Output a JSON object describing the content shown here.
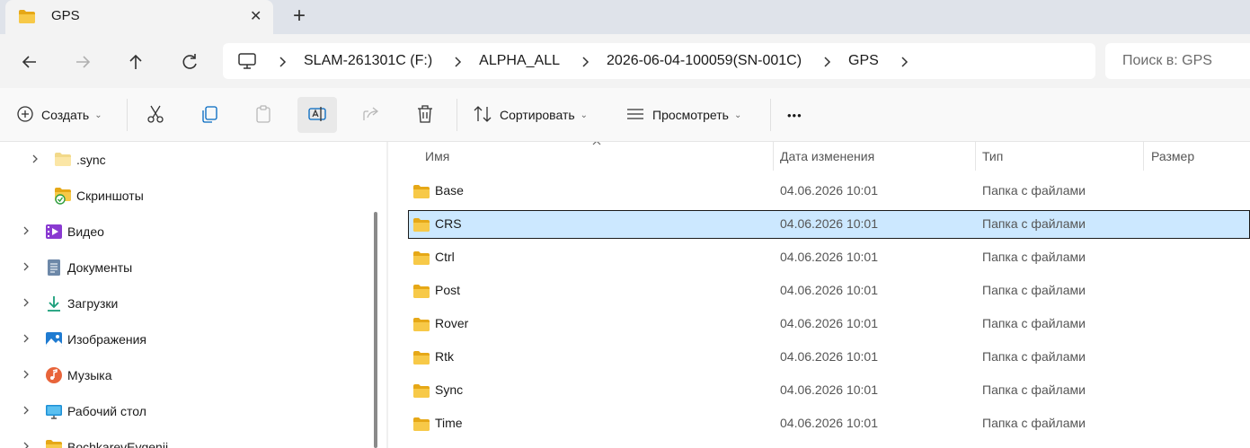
{
  "tab": {
    "title": "GPS",
    "close_glyph": "✕",
    "new_glyph": "+"
  },
  "breadcrumbs": [
    "SLAM-261301C (F:)",
    "ALPHA_ALL",
    "2026-06-04-100059(SN-001C)",
    "GPS"
  ],
  "search": {
    "placeholder": "Поиск в: GPS"
  },
  "toolbar": {
    "create_label": "Создать",
    "sort_label": "Сортировать",
    "view_label": "Просмотреть",
    "more_glyph": "•••",
    "dropdown_glyph": "⌄"
  },
  "nav": {
    "items": [
      {
        "label": ".sync",
        "icon": "folder-icon",
        "expandable": true
      },
      {
        "label": "Скриншоты",
        "icon": "synced-folder-icon",
        "expandable": false
      },
      {
        "label": "Видео",
        "icon": "videos-icon",
        "expandable": true
      },
      {
        "label": "Документы",
        "icon": "documents-icon",
        "expandable": true
      },
      {
        "label": "Загрузки",
        "icon": "downloads-icon",
        "expandable": true
      },
      {
        "label": "Изображения",
        "icon": "pictures-icon",
        "expandable": true
      },
      {
        "label": "Музыка",
        "icon": "music-icon",
        "expandable": true
      },
      {
        "label": "Рабочий стол",
        "icon": "desktop-icon",
        "expandable": true
      },
      {
        "label": "BochkarevEvgenii",
        "icon": "folder-icon",
        "expandable": true
      }
    ]
  },
  "columns": {
    "name": "Имя",
    "date": "Дата изменения",
    "type": "Тип",
    "size": "Размер"
  },
  "files": [
    {
      "name": "Base",
      "date": "04.06.2026 10:01",
      "type": "Папка с файлами",
      "size": ""
    },
    {
      "name": "CRS",
      "date": "04.06.2026 10:01",
      "type": "Папка с файлами",
      "size": "",
      "selected": true
    },
    {
      "name": "Ctrl",
      "date": "04.06.2026 10:01",
      "type": "Папка с файлами",
      "size": ""
    },
    {
      "name": "Post",
      "date": "04.06.2026 10:01",
      "type": "Папка с файлами",
      "size": ""
    },
    {
      "name": "Rover",
      "date": "04.06.2026 10:01",
      "type": "Папка с файлами",
      "size": ""
    },
    {
      "name": "Rtk",
      "date": "04.06.2026 10:01",
      "type": "Папка с файлами",
      "size": ""
    },
    {
      "name": "Sync",
      "date": "04.06.2026 10:01",
      "type": "Папка с файлами",
      "size": ""
    },
    {
      "name": "Time",
      "date": "04.06.2026 10:01",
      "type": "Папка с файлами",
      "size": ""
    }
  ],
  "colors": {
    "selection": "#cce8ff",
    "folder": "#f7c948",
    "folder_dark": "#e6a817",
    "accent": "#0067c0"
  }
}
